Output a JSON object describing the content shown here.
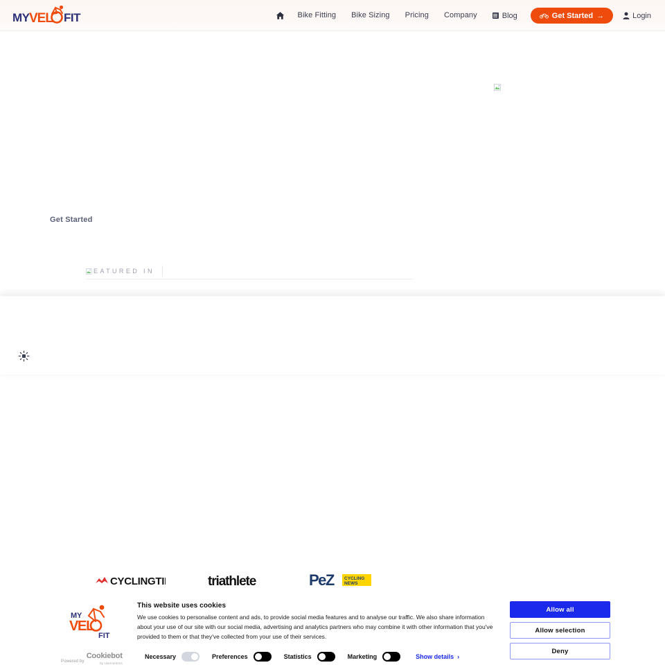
{
  "header": {
    "logo": {
      "part1": "MY",
      "part2": "VELO",
      "part3": "FIT",
      "icon": "cyclist-icon"
    },
    "nav": [
      {
        "label": "Bike Fitting"
      },
      {
        "label": "Bike Sizing"
      },
      {
        "label": "Pricing"
      },
      {
        "label": "Company"
      }
    ],
    "home_icon": "home-icon",
    "blog": {
      "label": "Blog",
      "icon": "blog-icon"
    },
    "get_started": {
      "label": "Get Started",
      "arrow": "→",
      "icon": "bicycle-icon",
      "color": "#ee4b0c"
    },
    "login": {
      "label": "Login",
      "icon": "user-icon"
    }
  },
  "hero": {
    "broken_image": "broken-image-icon",
    "cta_label": "Get Started"
  },
  "featured": {
    "label": "EATURED IN",
    "broken_image": "broken-image-icon",
    "logos": [
      {
        "name": "cyclingtips-logo",
        "text": "CYCLINGTIPS"
      },
      {
        "name": "triathlete-logo",
        "text": "triathlete"
      },
      {
        "name": "pez-cycling-news-logo",
        "text": "PeZ",
        "badge_line1": "CYCLING",
        "badge_line2": "NEWS",
        "badge_color": "#ffd400"
      }
    ]
  },
  "theme_toggle": {
    "icon": "sun-icon"
  },
  "cookie_banner": {
    "logo": {
      "part1": "MY",
      "part2": "VELO",
      "part3": "FIT"
    },
    "title": "This website uses cookies",
    "text": "We use cookies to personalise content and ads, to provide social media features and to analyse our traffic. We also share information about your use of our site with our social media, advertising and analytics partners who may combine it with other information that you've provided to them or that they've collected from your use of their services.",
    "buttons": [
      {
        "label": "Allow all",
        "style": "primary"
      },
      {
        "label": "Allow selection",
        "style": "secondary"
      },
      {
        "label": "Deny",
        "style": "secondary"
      }
    ],
    "powered_by": {
      "prefix": "Powered by",
      "brand": "Cookiebot",
      "sub": "by Usercentrics"
    },
    "toggles": [
      {
        "label": "Necessary",
        "state": "on-locked"
      },
      {
        "label": "Preferences",
        "state": "off"
      },
      {
        "label": "Statistics",
        "state": "off"
      },
      {
        "label": "Marketing",
        "state": "off"
      }
    ],
    "show_details": {
      "label": "Show details",
      "chevron": "›"
    }
  }
}
